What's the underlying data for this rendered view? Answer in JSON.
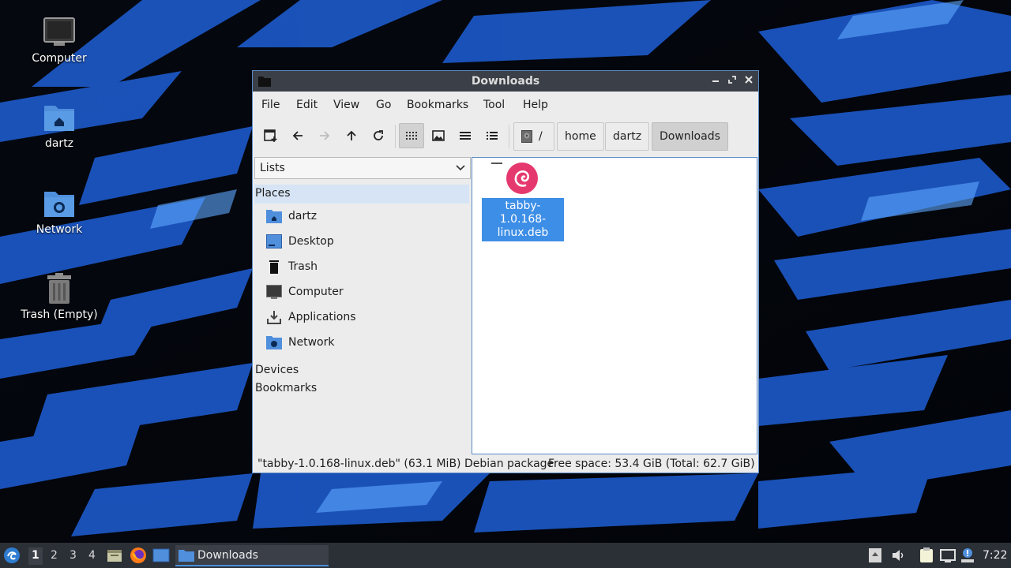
{
  "desktop": {
    "icons": [
      {
        "label": "Computer"
      },
      {
        "label": "dartz"
      },
      {
        "label": "Network"
      },
      {
        "label": "Trash (Empty)"
      }
    ]
  },
  "window": {
    "title": "Downloads",
    "menu": [
      "File",
      "Edit",
      "View",
      "Go",
      "Bookmarks",
      "Tool",
      "Help"
    ],
    "breadcrumbs": {
      "root": "/",
      "items": [
        "home",
        "dartz",
        "Downloads"
      ]
    },
    "side_panel": {
      "selector": "Lists",
      "places_heading": "Places",
      "places": [
        {
          "label": "dartz",
          "icon": "home-folder-icon"
        },
        {
          "label": "Desktop",
          "icon": "desktop-icon"
        },
        {
          "label": "Trash",
          "icon": "trash-icon"
        },
        {
          "label": "Computer",
          "icon": "computer-icon"
        },
        {
          "label": "Applications",
          "icon": "applications-icon"
        },
        {
          "label": "Network",
          "icon": "network-folder-icon"
        }
      ],
      "devices_heading": "Devices",
      "bookmarks_heading": "Bookmarks"
    },
    "files": [
      {
        "name": "tabby-1.0.168-linux.deb",
        "icon": "debian-package-icon",
        "selected": true
      }
    ],
    "status": {
      "left": "\"tabby-1.0.168-linux.deb\" (63.1 MiB) Debian package",
      "right": "Free space: 53.4 GiB (Total: 62.7 GiB)"
    }
  },
  "taskbar": {
    "workspaces": [
      "1",
      "2",
      "3",
      "4"
    ],
    "current_workspace": "1",
    "task": "Downloads",
    "clock": "7:22"
  },
  "colors": {
    "accent": "#3d8ee6",
    "titlebar": "#3b3f47",
    "taskbar": "#2b2f36",
    "debian": "#e5386f"
  }
}
